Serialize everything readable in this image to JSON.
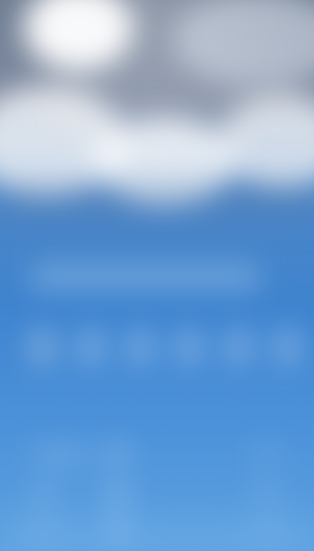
{
  "screen": {
    "state": "blurred weather app view",
    "background_top": "#7d8aa1",
    "background_bottom": "#5ea2e1",
    "accent": "#3f84cf"
  },
  "header": {
    "condition_icon": "cloud-icon"
  },
  "summary": {
    "text": ""
  },
  "hourly": {
    "items": [
      {
        "icon": "weather-icon",
        "label": ""
      },
      {
        "icon": "weather-icon",
        "label": ""
      },
      {
        "icon": "weather-icon",
        "label": ""
      },
      {
        "icon": "weather-icon",
        "label": ""
      },
      {
        "icon": "weather-icon",
        "label": ""
      },
      {
        "icon": "weather-icon",
        "label": ""
      }
    ]
  },
  "daily": {
    "rows": [
      {
        "day": "",
        "icon": "weather-icon",
        "temps": ""
      },
      {
        "day": "",
        "icon": "weather-icon",
        "temps": ""
      },
      {
        "day": "",
        "icon": "weather-icon",
        "temps": ""
      }
    ]
  }
}
